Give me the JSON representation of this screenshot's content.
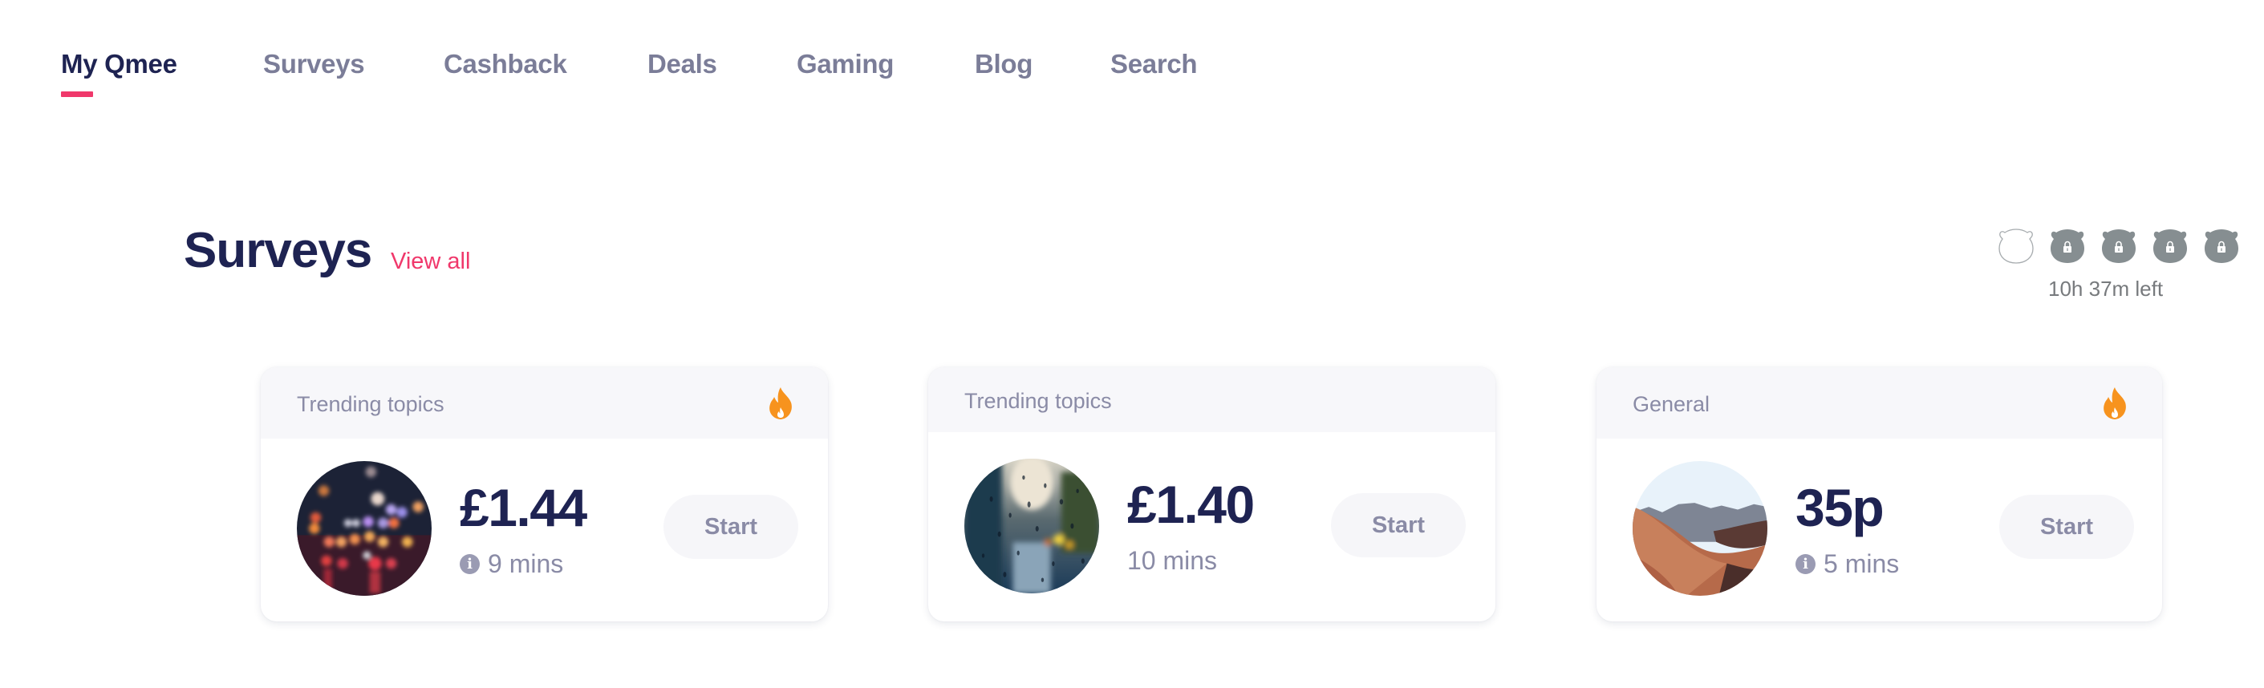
{
  "nav": {
    "items": [
      {
        "label": "My Qmee",
        "active": true
      },
      {
        "label": "Surveys",
        "active": false
      },
      {
        "label": "Cashback",
        "active": false
      },
      {
        "label": "Deals",
        "active": false
      },
      {
        "label": "Gaming",
        "active": false
      },
      {
        "label": "Blog",
        "active": false
      },
      {
        "label": "Search",
        "active": false
      }
    ]
  },
  "section": {
    "title": "Surveys",
    "view_all_label": "View all"
  },
  "streak": {
    "icons": [
      {
        "state": "unlocked-empty",
        "icon": "bear-outline-icon"
      },
      {
        "state": "locked",
        "icon": "bear-lock-icon"
      },
      {
        "state": "locked",
        "icon": "bear-lock-icon"
      },
      {
        "state": "locked",
        "icon": "bear-lock-icon"
      },
      {
        "state": "locked",
        "icon": "bear-lock-icon"
      }
    ],
    "time_left": "10h 37m left"
  },
  "surveys": [
    {
      "category": "Trending topics",
      "hot": true,
      "image": "city-lights-bokeh",
      "reward": "£1.44",
      "duration": "9 mins",
      "show_info_icon": true,
      "start_label": "Start"
    },
    {
      "category": "Trending topics",
      "hot": false,
      "image": "rainy-window",
      "reward": "£1.40",
      "duration": "10 mins",
      "show_info_icon": false,
      "start_label": "Start"
    },
    {
      "category": "General",
      "hot": true,
      "image": "desert-dunes",
      "reward": "35p",
      "duration": "5 mins",
      "show_info_icon": true,
      "start_label": "Start"
    }
  ],
  "colors": {
    "brand_navy": "#1E2352",
    "accent_pink": "#F0386B",
    "muted_text": "#8A8BA6",
    "nav_inactive": "#7B7D98",
    "flame_orange": "#F7931E",
    "bear_grey": "#868E91"
  }
}
